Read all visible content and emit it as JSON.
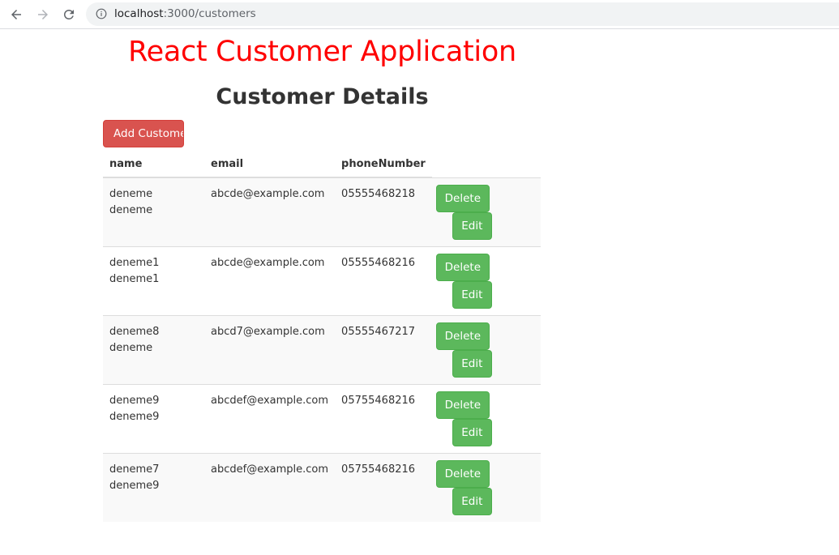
{
  "browser": {
    "url_host": "localhost",
    "url_path": ":3000/customers"
  },
  "page": {
    "app_title": "React Customer Application",
    "heading": "Customer Details",
    "add_button_label": "Add Customer"
  },
  "table": {
    "headers": [
      "name",
      "email",
      "phoneNumber"
    ],
    "rows": [
      {
        "name": "deneme deneme",
        "email": "abcde@example.com",
        "phone": "05555468218"
      },
      {
        "name": "deneme1 deneme1",
        "email": "abcde@example.com",
        "phone": "05555468216"
      },
      {
        "name": "deneme8 deneme",
        "email": "abcd7@example.com",
        "phone": "05555467217"
      },
      {
        "name": "deneme9 deneme9",
        "email": "abcdef@example.com",
        "phone": "05755468216"
      },
      {
        "name": "deneme7 deneme9",
        "email": "abcdef@example.com",
        "phone": "05755468216"
      }
    ],
    "delete_label": "Delete",
    "edit_label": "Edit"
  },
  "colors": {
    "title": "#ff0000",
    "danger": "#d9534f",
    "success": "#5cb85c"
  },
  "icons": {
    "back": "arrow-left-icon",
    "forward": "arrow-right-icon",
    "reload": "reload-icon",
    "info": "info-icon"
  }
}
